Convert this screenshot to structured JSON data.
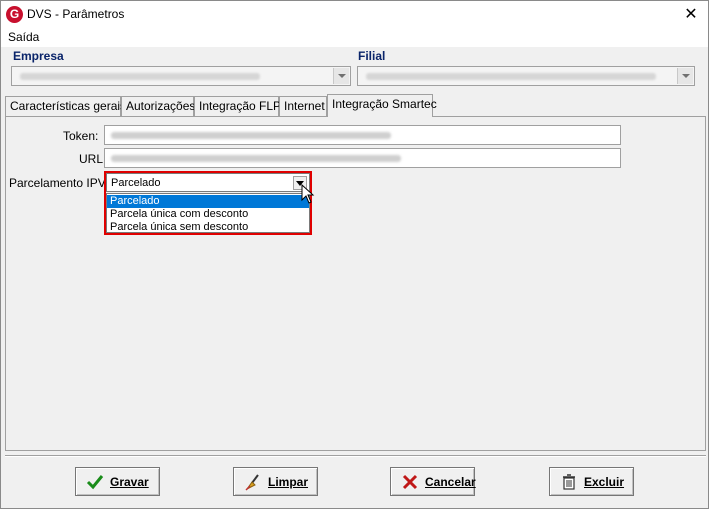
{
  "window": {
    "title": "DVS - Parâmetros",
    "close_glyph": "✕",
    "app_icon_letter": "G"
  },
  "menu": {
    "items": [
      "Saída"
    ]
  },
  "empresa": {
    "label": "Empresa"
  },
  "filial": {
    "label": "Filial"
  },
  "tabs": [
    "Características gerais",
    "Autorizações",
    "Integração FLP",
    "Internet",
    "Integração Smartec"
  ],
  "active_tab": "Integração Smartec",
  "form": {
    "token_label": "Token:",
    "url_label": "URL",
    "ipva_label": "Parcelamento IPVA",
    "ipva_value": "Parcelado",
    "ipva_options": [
      "Parcelado",
      "Parcela única com desconto",
      "Parcela única sem desconto"
    ],
    "ipva_selected_index": 0
  },
  "buttons": {
    "gravar": "Gravar",
    "limpar": "Limpar",
    "cancelar": "Cancelar",
    "excluir": "Excluir"
  },
  "colors": {
    "accent_selection": "#0078d7",
    "highlight_border": "#e00000",
    "group_label": "#0a246a"
  },
  "icons": {
    "gravar": "check-icon",
    "limpar": "broom-icon",
    "cancelar": "x-icon",
    "excluir": "trash-icon"
  }
}
